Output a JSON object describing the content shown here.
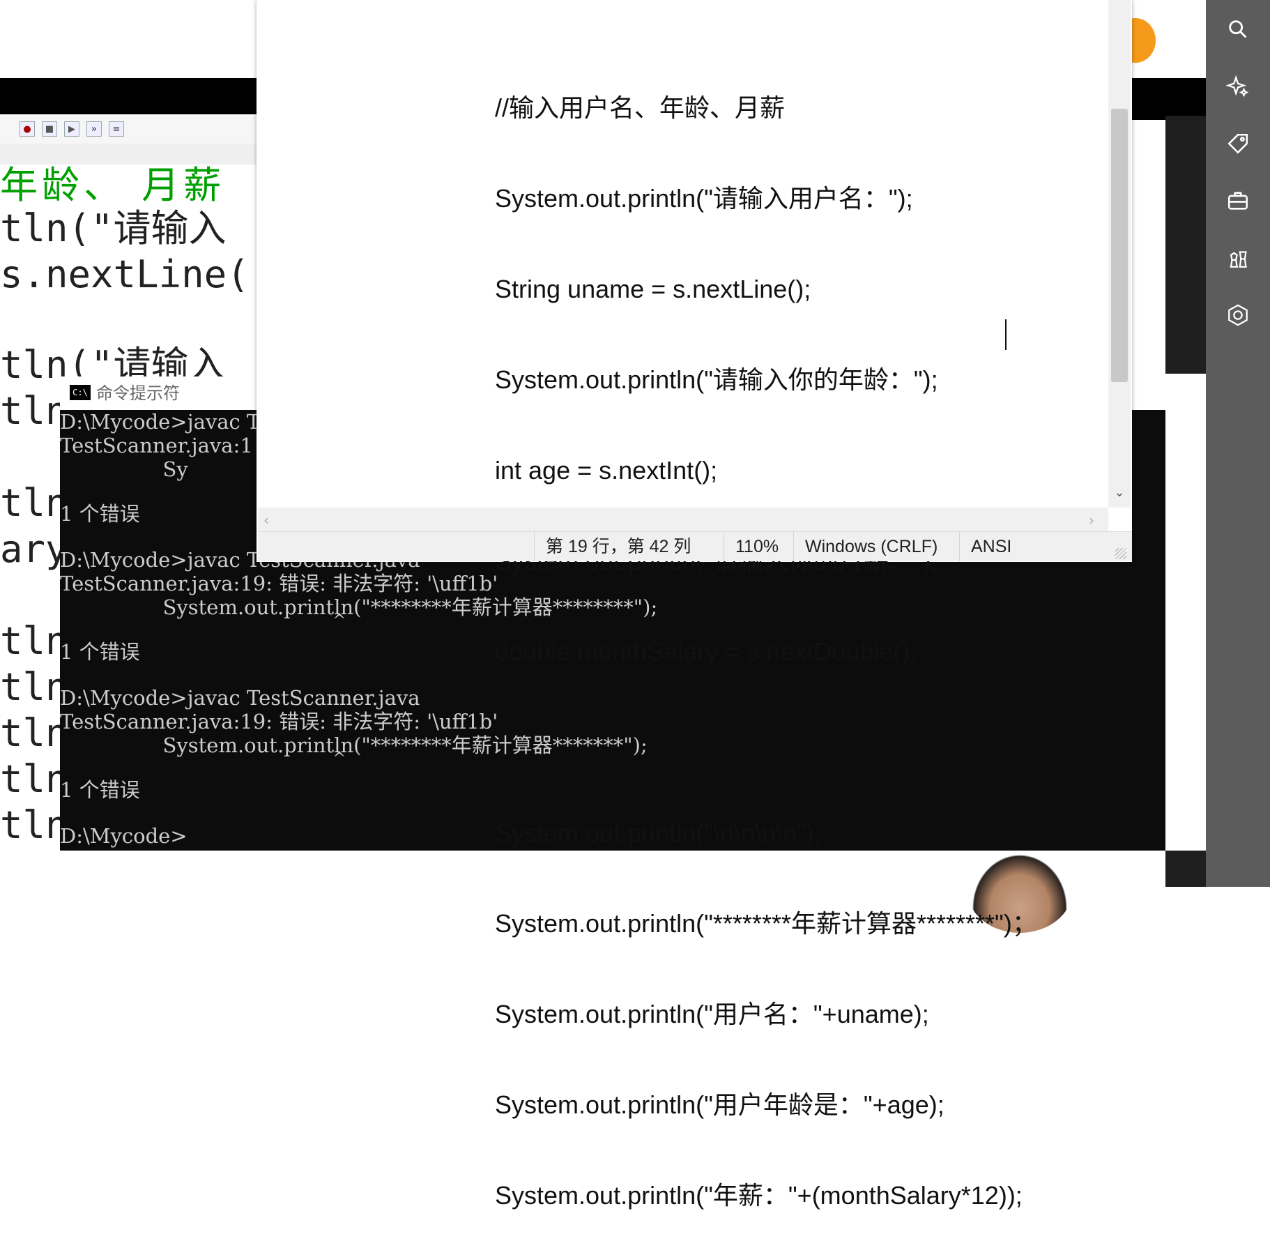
{
  "editor": {
    "code_lines": [
      "年龄、 月薪",
      "tln(\"请输入",
      "s.nextLine(",
      "",
      "tln(\"请输入",
      "tln",
      "",
      "tln",
      "ary",
      "",
      "tln",
      "tln",
      "tln",
      "tln",
      "tln"
    ]
  },
  "cmd": {
    "title": "命令提示符",
    "lines": [
      "D:\\Mycode>javac Te",
      "TestScanner.java:1",
      "                Sy",
      "",
      "1 个错误",
      "",
      "D:\\Mycode>javac TestScanner.java",
      "TestScanner.java:19: 错误: 非法字符: '\\uff1b'",
      "                System.out.println(\"********年薪计算器********\");",
      "                                                        ^",
      "1 个错误",
      "",
      "D:\\Mycode>javac TestScanner.java",
      "TestScanner.java:19: 错误: 非法字符: '\\uff1b'",
      "                System.out.println(\"********年薪计算器*******\");",
      "                                                        ^",
      "1 个错误",
      "",
      "D:\\Mycode>"
    ]
  },
  "notepad": {
    "lines": [
      "//输入用户名、年龄、月薪",
      "System.out.println(\"请输入用户名：\");",
      "String uname = s.nextLine();",
      "System.out.println(\"请输入你的年龄：\");",
      "int age = s.nextInt();",
      "System.out.println(\"请输入你的月薪：\");",
      "double monthSalary = s.nextDouble();",
      "",
      "System.out.println(\"\\n\\n\\n\\n\");",
      "System.out.println(\"********年薪计算器********\")；",
      "System.out.println(\"用户名：\"+uname);",
      "System.out.println(\"用户年龄是：\"+age);",
      "System.out.println(\"年薪：\"+(monthSalary*12));"
    ],
    "status": {
      "position": "第 19 行，第 42 列",
      "zoom": "110%",
      "line_ending": "Windows (CRLF)",
      "encoding": "ANSI"
    }
  },
  "sidebar": {
    "icons": [
      "search-icon",
      "sparkle-icon",
      "tag-icon",
      "toolbox-icon",
      "chess-icon",
      "apps-icon"
    ]
  }
}
